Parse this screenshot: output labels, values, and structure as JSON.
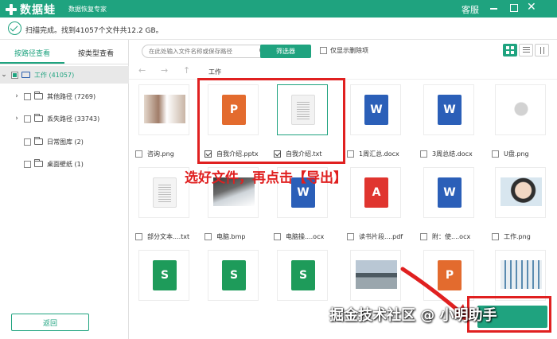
{
  "app": {
    "name": "数据蛙",
    "subtitle": "数据恢复专家",
    "service": "客服"
  },
  "status": {
    "text": "扫描完成。找到41057个文件共12.2 GB。"
  },
  "sidebar": {
    "tabs": [
      "按路径查看",
      "按类型查看"
    ],
    "tree": [
      {
        "label": "工作 (41057)"
      },
      {
        "label": "其他路径 (7269)"
      },
      {
        "label": "丢失路径 (33743)"
      },
      {
        "label": "日常图库 (2)"
      },
      {
        "label": "桌面壁纸 (1)"
      }
    ],
    "back_label": "返回"
  },
  "toolbar": {
    "search_placeholder": "在此处输入文件名称或保存路径",
    "filter_label": "筛选器",
    "only_deleted_label": "仅显示删除项"
  },
  "breadcrumb": "工作",
  "files": [
    {
      "name": "咨询.png",
      "checked": false
    },
    {
      "name": "自我介绍.pptx",
      "checked": true
    },
    {
      "name": "自我介绍.txt",
      "checked": true
    },
    {
      "name": "1周汇总.docx",
      "checked": false
    },
    {
      "name": "3周总结.docx",
      "checked": false
    },
    {
      "name": "U盘.png",
      "checked": false
    },
    {
      "name": "部分文本....txt",
      "checked": false
    },
    {
      "name": "电脑.bmp",
      "checked": false
    },
    {
      "name": "电脑操....ocx",
      "checked": false
    },
    {
      "name": "读书片段....pdf",
      "checked": false
    },
    {
      "name": "附：使....ocx",
      "checked": false
    },
    {
      "name": "工作.png",
      "checked": false
    }
  ],
  "icons": {
    "file_types": [
      "photo-icon",
      "ppt-icon",
      "txt-icon",
      "word-icon",
      "word-icon",
      "photo-icon",
      "txt-icon",
      "photo-icon",
      "word-icon",
      "pdf-icon",
      "word-icon",
      "photo-icon",
      "sheet-icon",
      "sheet-icon",
      "sheet-icon",
      "photo-icon",
      "ppt-icon",
      "photo-icon"
    ]
  },
  "annotation": "选好文件，再点击【导出】",
  "watermark": "掘金技术社区 @ 小明助手",
  "colors": {
    "accent": "#1fa37f",
    "highlight": "#e02020"
  }
}
